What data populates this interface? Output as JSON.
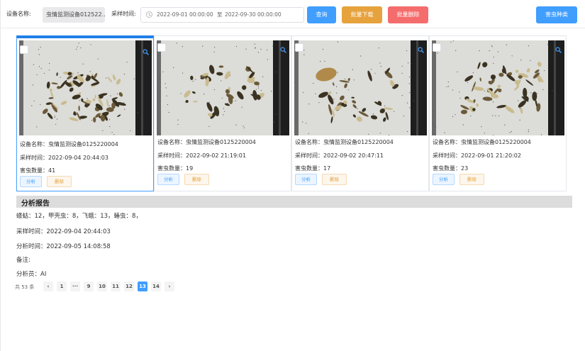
{
  "toolbar": {
    "device_label": "设备名称:",
    "device_value": "虫情监测设备012522...",
    "time_label": "采样时间:",
    "start_time": "2022-09-01 00:00:00",
    "range_separator": "至",
    "end_time": "2022-09-30 00:00:00",
    "query_label": "查询",
    "batch_download_label": "批量下载",
    "batch_delete_label": "批量删除",
    "pest_species_label": "害虫种类"
  },
  "cards": [
    {
      "device": "设备名称：虫情监测设备0125220004",
      "time": "采样时间：2022-09-04 20:44:03",
      "count": "害虫数量：41",
      "analyze": "分析",
      "delete": "删除",
      "selected": true
    },
    {
      "device": "设备名称：虫情监测设备0125220004",
      "time": "采样时间：2022-09-02 21:19:01",
      "count": "害虫数量：19",
      "analyze": "分析",
      "delete": "删除",
      "selected": false
    },
    {
      "device": "设备名称：虫情监测设备0125220004",
      "time": "采样时间：2022-09-02 20:47:11",
      "count": "害虫数量：17",
      "analyze": "分析",
      "delete": "删除",
      "selected": false
    },
    {
      "device": "设备名称：虫情监测设备0125220004",
      "time": "采样时间：2022-09-01 21:20:02",
      "count": "害虫数量：23",
      "analyze": "分析",
      "delete": "删除",
      "selected": false
    }
  ],
  "report": {
    "title": "分析报告",
    "pests": "蝼蛄：12，甲壳虫：8，飞蛾：13，蝽虫：8，",
    "sample_time": "采样时间：2022-09-04 20:44:03",
    "analysis_time": "分析时间：2022-09-05 14:08:58",
    "remark": "备注:",
    "analyst": "分析员：AI"
  },
  "pagination": {
    "total": "共 53 条",
    "prev": "‹",
    "pages": [
      "1",
      "···",
      "9",
      "10",
      "11",
      "12",
      "13",
      "14"
    ],
    "next": "›",
    "current": "13"
  },
  "colors": {
    "primary": "#409eff",
    "warning": "#e6a23c",
    "danger": "#f56c6c"
  }
}
